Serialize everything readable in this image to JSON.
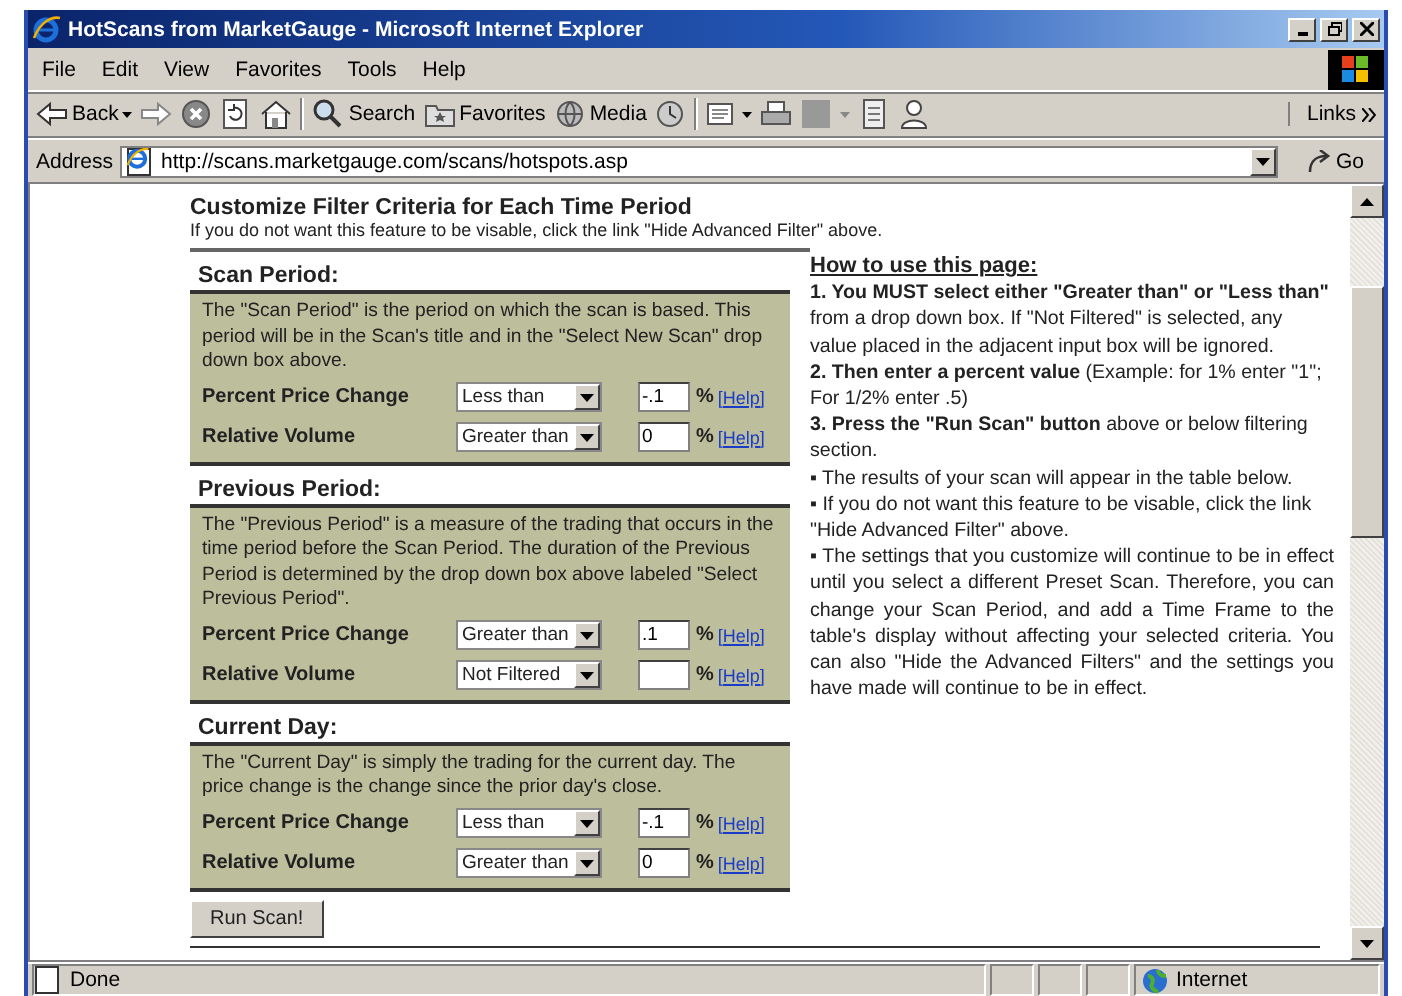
{
  "window": {
    "title": "HotScans from MarketGauge - Microsoft Internet Explorer"
  },
  "menu": [
    "File",
    "Edit",
    "View",
    "Favorites",
    "Tools",
    "Help"
  ],
  "toolbar": {
    "back": "Back",
    "search": "Search",
    "favorites": "Favorites",
    "media": "Media",
    "links": "Links"
  },
  "address_bar": {
    "label": "Address",
    "url": "http://scans.marketgauge.com/scans/hotspots.asp",
    "go": "Go"
  },
  "page": {
    "heading": "Customize Filter Criteria for Each Time Period",
    "subheading": "If you do not want this feature to be visable, click the link \"Hide Advanced Filter\" above.",
    "sections": [
      {
        "title": "Scan Period:",
        "description": "The \"Scan Period\" is the period on which the scan is based. This period will be in the Scan's title and in the \"Select New Scan\" drop down box above.",
        "rows": [
          {
            "label": "Percent Price Change",
            "filter": "Less than",
            "value": "-.1",
            "unit": "%",
            "help": "[Help]"
          },
          {
            "label": "Relative Volume",
            "filter": "Greater than",
            "value": "0",
            "unit": "%",
            "help": "[Help]"
          }
        ]
      },
      {
        "title": "Previous Period:",
        "description": "The \"Previous Period\" is a measure of the trading that occurs in the time period before the Scan Period. The duration of the Previous Period is determined by the drop down box above labeled \"Select Previous Period\".",
        "rows": [
          {
            "label": "Percent Price Change",
            "filter": "Greater than",
            "value": ".1",
            "unit": "%",
            "help": "[Help]"
          },
          {
            "label": "Relative Volume",
            "filter": "Not Filtered",
            "unit": "%",
            "help": "[Help]"
          }
        ]
      },
      {
        "title": "Current Day:",
        "description": "The \"Current Day\" is simply the trading for the current day. The price change is the change since the prior day's close.",
        "rows": [
          {
            "label": "Percent Price Change",
            "filter": "Less than",
            "value": "-.1",
            "unit": "%",
            "help": "[Help]"
          },
          {
            "label": "Relative Volume",
            "filter": "Greater than",
            "value": "0",
            "unit": "%",
            "help": "[Help]"
          }
        ]
      }
    ],
    "run_button": "Run Scan!",
    "help": {
      "title": "How to use this page:",
      "paragraphs": [
        "**1. You MUST select either \"Greater than\" or \"Less than\"** from a drop down box. If \"Not Filtered\" is selected, any value placed in the adjacent input box will be ignored.",
        "**2. Then enter a percent value** (Example: for 1% enter \"1\"; For 1/2% enter .5)",
        "**3. Press the \"Run Scan\" button** above or below filtering section.",
        "▪  The results of your scan will appear in the table below.",
        "▪  If you do not want this feature to be visable, click the link \"Hide Advanced Filter\" above.",
        "▪  The settings that you customize will continue to be in effect until you select a different Preset Scan. Therefore, you can change your Scan Period, and add a Time Frame to the table's display without affecting your selected criteria. You can also \"Hide the Advanced Filters\" and the settings you have made will continue to be in effect."
      ]
    }
  },
  "status_bar": {
    "status": "Done",
    "zone": "Internet"
  }
}
